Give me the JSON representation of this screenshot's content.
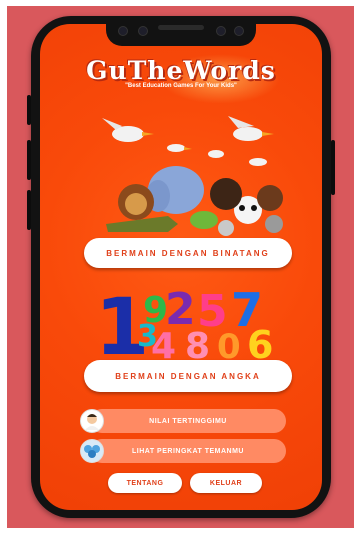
{
  "app": {
    "logo_title": "GuTheWords",
    "logo_tagline": "\"Best Education Games For Your Kids\""
  },
  "menu": {
    "animals_label": "BERMAIN DENGAN BINATANG",
    "numbers_label": "BERMAIN DENGAN ANGKA",
    "highscore_label": "NILAI TERTINGGIMU",
    "leaderboard_label": "LIHAT PERINGKAT TEMANMU",
    "about_label": "TENTANG",
    "exit_label": "KELUAR"
  },
  "illustrations": {
    "numbers_digits": [
      "1",
      "9",
      "2",
      "5",
      "7",
      "3",
      "4",
      "8",
      "0",
      "6"
    ]
  },
  "colors": {
    "background": "#d9585c",
    "screen": "#f94a0a",
    "accent_text": "#e0401a",
    "secondary_button": "#ff8a63"
  }
}
